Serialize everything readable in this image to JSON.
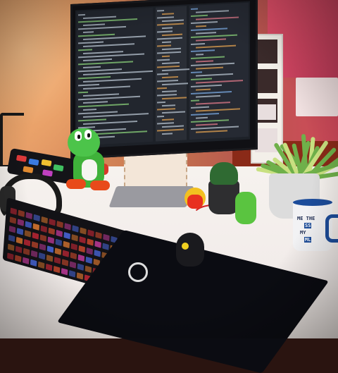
{
  "scene": {
    "description_colors": {
      "wall_warm": "#e8a06a",
      "wall_magenta": "#d0485a",
      "desk": "#f4efeb",
      "mousepad": "#0b0c12",
      "yoshi_green": "#4cc44a",
      "mug_blue": "#1c4c9a"
    }
  },
  "mug": {
    "line1_a": "ME THE",
    "line2_a": "SS",
    "line3_a": "MY",
    "line4_a": "ML"
  },
  "mousepad": {
    "logo_icon": "steelseries-logo-icon"
  }
}
